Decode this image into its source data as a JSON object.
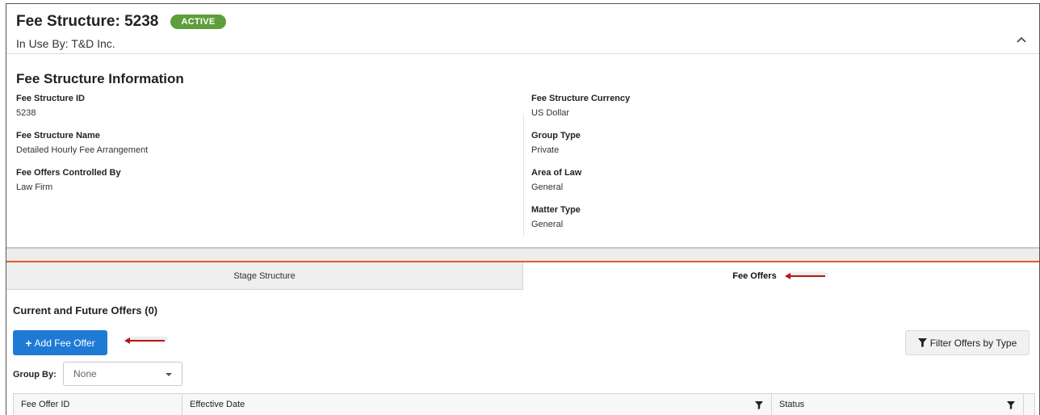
{
  "header": {
    "title": "Fee Structure: 5238",
    "status": "ACTIVE",
    "in_use_by": "In Use By: T&D Inc."
  },
  "info": {
    "section_title": "Fee Structure Information",
    "left": [
      {
        "label": "Fee Structure ID",
        "value": "5238"
      },
      {
        "label": "Fee Structure Name",
        "value": "Detailed Hourly Fee Arrangement"
      },
      {
        "label": "Fee Offers Controlled By",
        "value": "Law Firm"
      }
    ],
    "right": [
      {
        "label": "Fee Structure Currency",
        "value": "US Dollar"
      },
      {
        "label": "Group Type",
        "value": "Private"
      },
      {
        "label": "Area of Law",
        "value": "General"
      },
      {
        "label": "Matter Type",
        "value": "General"
      }
    ]
  },
  "tabs": [
    {
      "label": "Stage Structure",
      "active": false
    },
    {
      "label": "Fee Offers",
      "active": true
    }
  ],
  "offers": {
    "title": "Current and Future Offers (0)",
    "add_label": "Add Fee Offer",
    "filter_label": "Filter Offers by Type",
    "group_by_label": "Group By:",
    "group_by_value": "None"
  },
  "table": {
    "columns": [
      "Fee Offer ID",
      "Effective Date",
      "Status"
    ]
  },
  "colors": {
    "status_badge": "#5e9e3b",
    "primary_button": "#1f7ad6",
    "accent_line": "#e05a2b",
    "annotation_arrow": "#b51818"
  }
}
